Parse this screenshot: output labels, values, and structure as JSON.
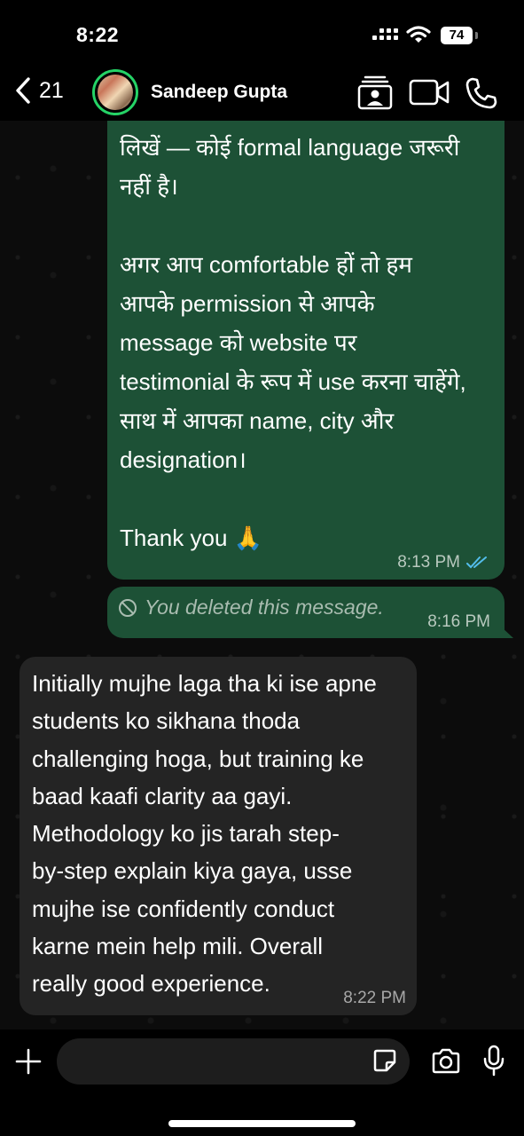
{
  "status": {
    "time": "8:22",
    "battery": "74"
  },
  "header": {
    "back_count": "21",
    "contact_name": "Sandeep Gupta"
  },
  "messages": [
    {
      "direction": "outgoing",
      "text": "लिखें — कोई formal language जरूरी\nनहीं है।\n\nअगर आप comfortable हों तो हम\nआपके permission से आपके\nmessage को website पर\ntestimonial के रूप में use करना चाहेंगे,\nसाथ में आपका name, city और\ndesignation।\n\nThank you 🙏",
      "time": "8:13 PM",
      "status": "read"
    },
    {
      "direction": "outgoing",
      "text": "You deleted this message.",
      "time": "8:16 PM",
      "deleted": true
    },
    {
      "direction": "incoming",
      "text": "Initially mujhe laga tha ki ise apne\nstudents ko sikhana thoda\nchallenging hoga, but training ke\nbaad kaafi clarity aa gayi.\nMethodology ko jis tarah step-\nby-step explain kiya gaya, usse\nmujhe ise confidently conduct\nkarne mein help mili. Overall\nreally good experience.",
      "time": "8:22 PM"
    }
  ],
  "composer": {
    "value": "",
    "placeholder": ""
  },
  "colors": {
    "accent": "#25d366",
    "outgoing_bubble": "#1d5136",
    "incoming_bubble": "#242424",
    "read_ticks": "#53bdeb"
  },
  "icons": [
    "back-chevron-icon",
    "contact-card-icon",
    "video-call-icon",
    "phone-icon",
    "plus-icon",
    "sticker-icon",
    "camera-icon",
    "microphone-icon",
    "deleted-icon",
    "read-ticks-icon"
  ]
}
